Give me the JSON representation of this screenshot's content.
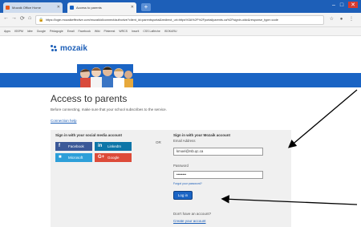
{
  "browser": {
    "tabs": [
      {
        "label": "Mozaik Office Home",
        "active": false
      },
      {
        "label": "Access to parents",
        "active": true
      }
    ],
    "url": "https://login.mozaikeffective.com/mozaikid/connect/authorize?client_id=parentsportal&redirect_uri=https%3A%2F%2Fportailparents.ca%2Fsignin-oidc&response_type=code",
    "bookmarks": [
      "Apps",
      "ISSPM",
      "Idée",
      "Google",
      "Pédagogie",
      "Email",
      "Facebook",
      "Wiki",
      "Pinterest",
      "WRCS",
      "Inscrit",
      "CSS Laflèche",
      "ISOKARU"
    ]
  },
  "page": {
    "brand": "mozaik",
    "title": "Access to parents",
    "subtitle": "Before connecting, make sure that your school subscribes to the service.",
    "connection_help": "Connection help",
    "social": {
      "title": "Sign in with your social media account",
      "buttons": [
        {
          "icon": "f",
          "label": "Facebook",
          "color": "#3b5998"
        },
        {
          "icon": "in",
          "label": "LinkedIn",
          "color": "#0e76a8"
        },
        {
          "icon": "■",
          "label": "Microsoft",
          "color": "#2d9fd9"
        },
        {
          "icon": "G+",
          "label": "Google",
          "color": "#dd4b39"
        }
      ]
    },
    "or_label": "OR",
    "mozaik": {
      "title": "Sign in with your Mozaik account",
      "email_label": "Email Address",
      "email_value": "kmoel@rsb.qc.ca",
      "password_label": "Password",
      "password_value": "••••••••",
      "forgot": "Forgot your password?",
      "login_button": "Log in",
      "no_account": "Don't have an account?",
      "create": "Create your account"
    }
  },
  "colors": {
    "brand_blue": "#1a64c4",
    "panel_bg": "#f0f0f0"
  }
}
